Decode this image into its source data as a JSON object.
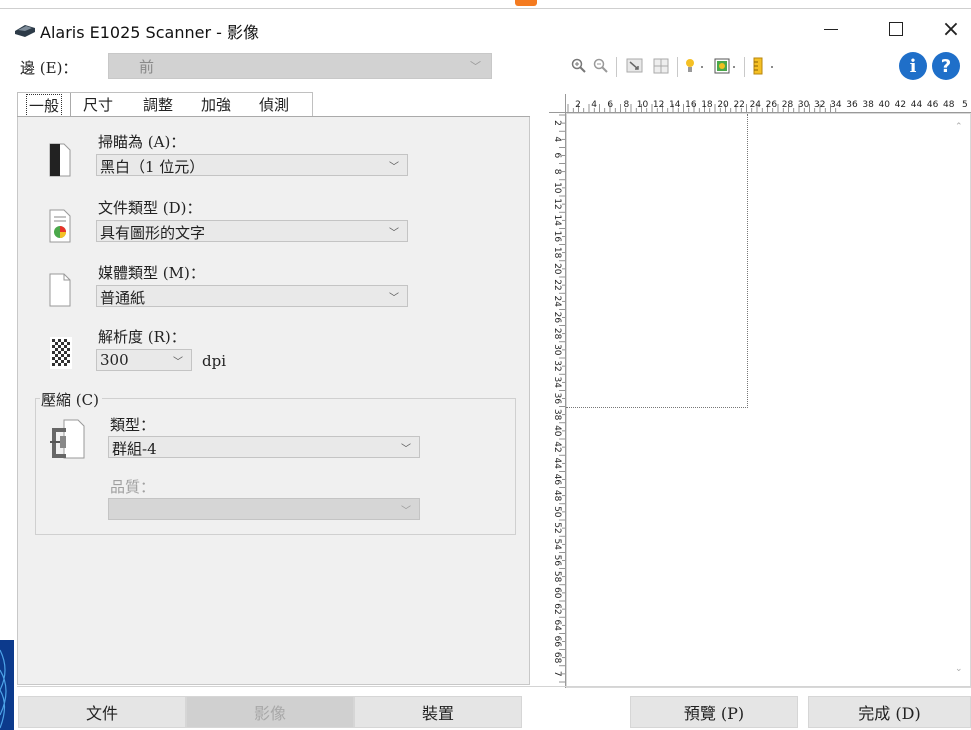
{
  "window": {
    "title": "Alaris E1025 Scanner - 影像",
    "minimize": "minimize",
    "maximize": "maximize",
    "close": "×"
  },
  "side": {
    "label": "邊 (E)：",
    "value": "前"
  },
  "tabs": [
    {
      "label": "一般",
      "active": true
    },
    {
      "label": "尺寸",
      "active": false
    },
    {
      "label": "調整",
      "active": false
    },
    {
      "label": "加強",
      "active": false
    },
    {
      "label": "偵測",
      "active": false
    }
  ],
  "general": {
    "scan_as": {
      "label": "掃瞄為 (A)：",
      "value": "黑白（1 位元）"
    },
    "document_type": {
      "label": "文件類型 (D)：",
      "value": "具有圖形的文字"
    },
    "media_type": {
      "label": "媒體類型 (M)：",
      "value": "普通紙"
    },
    "resolution": {
      "label": "解析度 (R)：",
      "value": "300",
      "unit": "dpi"
    },
    "compression": {
      "legend": "壓縮 (C)",
      "type_label": "類型：",
      "type_value": "群組-4",
      "quality_label": "品質：",
      "quality_value": ""
    }
  },
  "toolbar": {
    "icons": [
      "zoom-in-icon",
      "zoom-out-icon",
      "crop-icon",
      "grid-icon",
      "light-icon",
      "color-icon",
      "ruler-icon"
    ],
    "info": "i",
    "help": "?"
  },
  "ruler": {
    "top_ticks": [
      "2",
      "4",
      "6",
      "8",
      "10",
      "12",
      "14",
      "16",
      "18",
      "20",
      "22",
      "24",
      "26",
      "28",
      "30",
      "32",
      "34",
      "36",
      "38",
      "40",
      "42",
      "44",
      "46",
      "48",
      "5"
    ],
    "left_ticks": [
      "2",
      "4",
      "6",
      "8",
      "10",
      "12",
      "14",
      "16",
      "18",
      "20",
      "22",
      "24",
      "26",
      "28",
      "30",
      "32",
      "34",
      "36",
      "38",
      "40",
      "42",
      "44",
      "46",
      "48",
      "50",
      "52",
      "54",
      "56",
      "58",
      "60",
      "62",
      "64",
      "66",
      "68",
      "7"
    ]
  },
  "bottom": {
    "document": "文件",
    "image": "影像",
    "device": "裝置",
    "preview": "預覽 (P)",
    "done": "完成 (D)"
  },
  "colors": {
    "accent_blue": "#1f6fc9",
    "top_accent_orange": "#f47b20",
    "panel_bg": "#f0f0f0"
  }
}
